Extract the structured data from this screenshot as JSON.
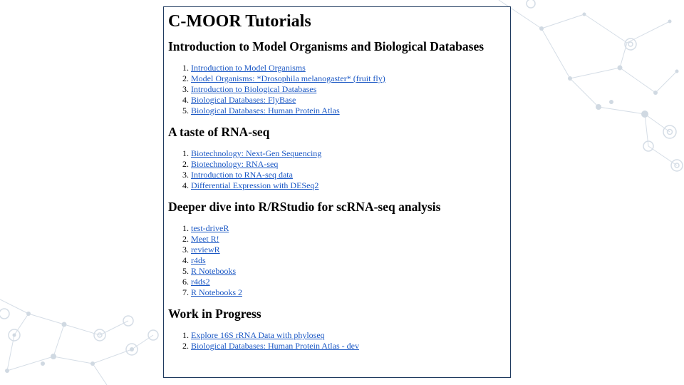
{
  "page": {
    "title": "C-MOOR Tutorials"
  },
  "sections": [
    {
      "heading": "Introduction to Model Organisms and Biological Databases",
      "links": [
        "Introduction to Model Organisms",
        "Model Organisms: *Drosophila melanogaster* (fruit fly)",
        "Introduction to Biological Databases",
        "Biological Databases: FlyBase",
        "Biological Databases: Human Protein Atlas"
      ]
    },
    {
      "heading": "A taste of RNA-seq",
      "links": [
        "Biotechnology: Next-Gen Sequencing",
        "Biotechnology: RNA-seq",
        "Introduction to RNA-seq data",
        "Differential Expression with DESeq2"
      ]
    },
    {
      "heading": "Deeper dive into R/RStudio for scRNA-seq analysis",
      "links": [
        "test-driveR",
        "Meet R!",
        "reviewR",
        "r4ds",
        "R Notebooks",
        "r4ds2",
        "R Notebooks 2"
      ]
    },
    {
      "heading": "Work in Progress",
      "links": [
        "Explore 16S rRNA Data with phyloseq",
        "Biological Databases: Human Protein Atlas - dev"
      ]
    }
  ],
  "colors": {
    "link": "#1a57c4",
    "panel_border": "#1f3a5f",
    "decoration": "#c9d3dd"
  }
}
